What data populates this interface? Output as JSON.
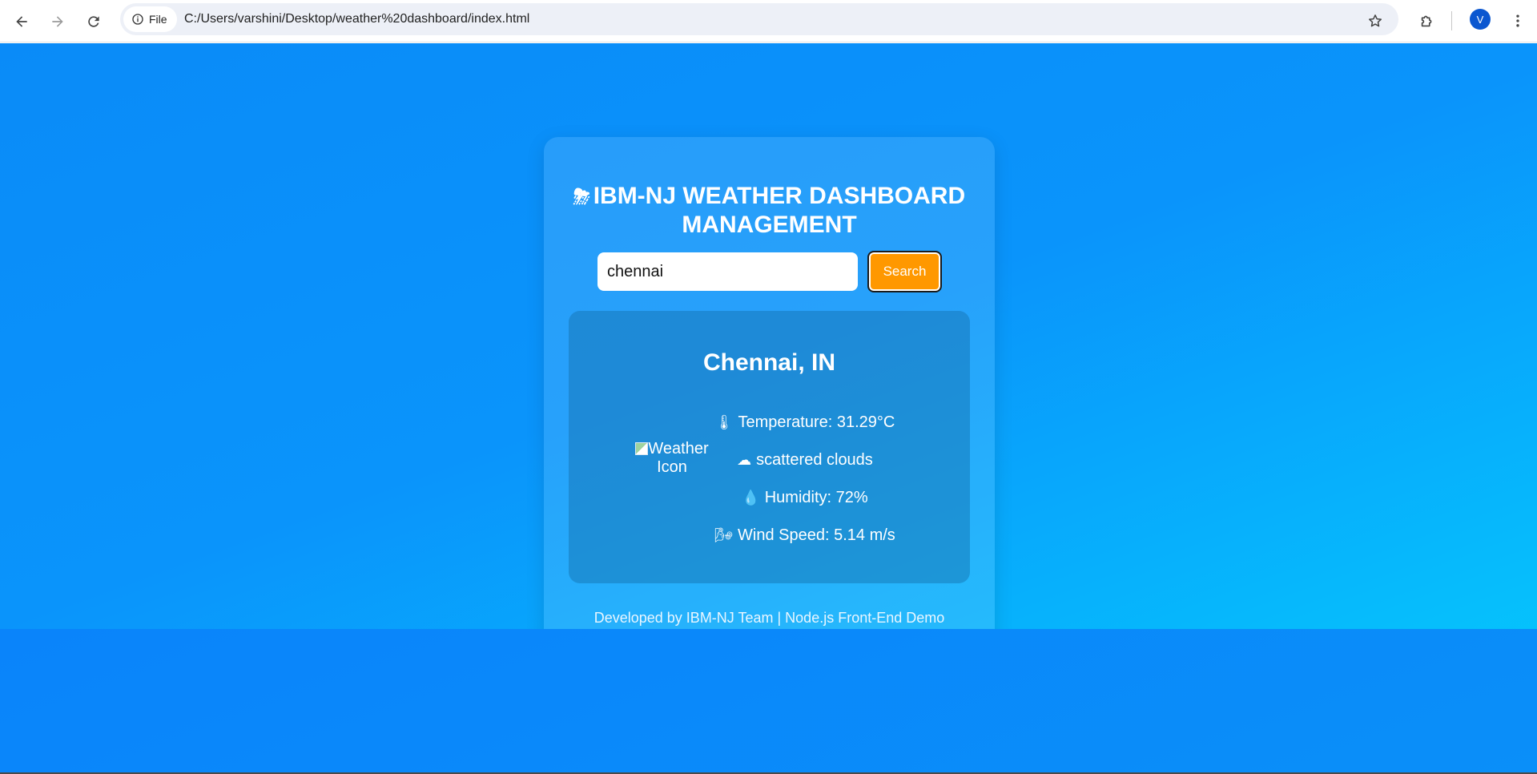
{
  "browser": {
    "site_chip_label": "File",
    "url": "C:/Users/varshini/Desktop/weather%20dashboard/index.html",
    "avatar_letter": "V"
  },
  "page": {
    "title_icon": "⛈",
    "title": "IBM-NJ WEATHER DASHBOARD MANAGEMENT",
    "search": {
      "value": "chennai",
      "button_label": "Search"
    },
    "result": {
      "city": "Chennai, IN",
      "icon_alt": "Weather Icon",
      "temperature": {
        "icon": "🌡",
        "text": "Temperature: 31.29°C"
      },
      "description": {
        "icon": "☁",
        "text": "scattered clouds"
      },
      "humidity": {
        "icon": "💧",
        "text": "Humidity: 72%"
      },
      "wind": {
        "icon": "🌬",
        "text": "Wind Speed: 5.14 m/s"
      }
    },
    "footer": "Developed by IBM-NJ Team | Node.js Front-End Demo"
  },
  "colors": {
    "background_start": "#0a8bf8",
    "background_end": "#04cdfd",
    "search_button": "#ff9800",
    "avatar": "#0b57d0"
  }
}
